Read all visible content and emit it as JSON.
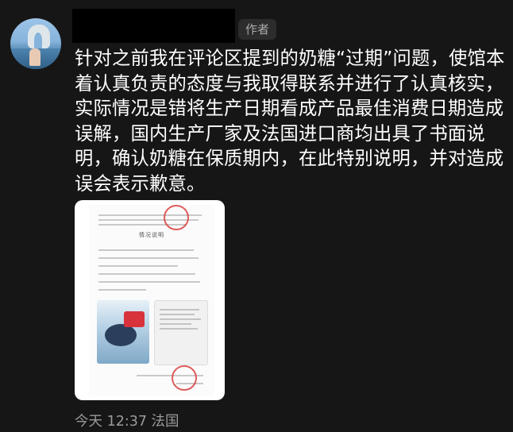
{
  "comment": {
    "author_badge": "作者",
    "text": "针对之前我在评论区提到的奶糖“过期”问题，使馆本着认真负责的态度与我取得联系并进行了认真核实，实际情况是错将生产日期看成产品最佳消费日期造成误解，国内生产厂家及法国进口商均出具了书面说明，确认奶糖在保质期内，在此特别说明，并对造成误会表示歉意。",
    "timestamp": "今天 12:37 法国"
  },
  "attachment": {
    "doc_title": "情况说明"
  },
  "icons": {
    "avatar": "avatar-photo",
    "redaction": "redacted-username"
  },
  "colors": {
    "background": "#161616",
    "text": "#ffffff",
    "meta": "#9a9a9a",
    "badge_bg": "#2c2c2c"
  }
}
